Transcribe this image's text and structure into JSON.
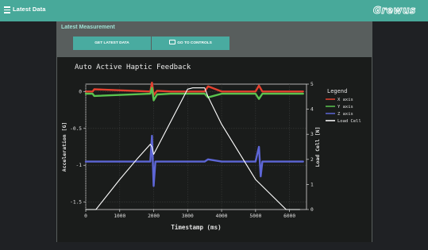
{
  "app": {
    "title": "Latest Data",
    "logo_text": "Grewus"
  },
  "panel": {
    "title": "Latest Measurement",
    "buttons": {
      "latest": "GET LATEST DATA",
      "controls": "GO TO CONTROLS"
    }
  },
  "colors": {
    "topbar": "#48a99a",
    "x_axis": "#e4412f",
    "y_axis": "#5ac44f",
    "z_axis": "#5d66d6",
    "load_cell": "#ffffff"
  },
  "chart_data": {
    "type": "line",
    "title": "Auto Active Haptic Feedback",
    "xlabel": "Timestamp (ms)",
    "ylabel_left": "Acceleration [G]",
    "ylabel_right": "Load Cell [N]",
    "xlim": [
      0,
      6500
    ],
    "ylim_left": [
      -1.6,
      0.1
    ],
    "ylim_right": [
      0,
      5
    ],
    "x_ticks": [
      "0",
      "1000",
      "2000",
      "3000",
      "4000",
      "5000",
      "6000"
    ],
    "y_ticks_left": [
      "0",
      "-0.5",
      "-1",
      "-1.5"
    ],
    "y_ticks_right": [
      "0",
      "1",
      "2",
      "3",
      "4",
      "5"
    ],
    "legend": {
      "title": "Legend",
      "position": "right",
      "entries": [
        "X axis",
        "Y axis",
        "Z axis",
        "Load Cell"
      ]
    },
    "series": [
      {
        "name": "X axis",
        "axis": "left",
        "x": [
          0,
          200,
          250,
          1900,
          1950,
          2000,
          2100,
          2500,
          3000,
          3500,
          3600,
          4000,
          5000,
          5100,
          5200,
          6400
        ],
        "y": [
          0.0,
          0.0,
          0.03,
          0.0,
          0.12,
          -0.05,
          0.01,
          0.0,
          0.0,
          0.0,
          0.07,
          0.0,
          0.0,
          0.08,
          0.0,
          0.0
        ]
      },
      {
        "name": "Y axis",
        "axis": "left",
        "x": [
          0,
          200,
          250,
          1900,
          1950,
          2000,
          2100,
          2500,
          3000,
          3500,
          3600,
          4000,
          5000,
          5100,
          5200,
          6400
        ],
        "y": [
          -0.03,
          -0.03,
          -0.06,
          -0.03,
          0.05,
          -0.12,
          -0.04,
          -0.03,
          -0.03,
          -0.03,
          -0.08,
          -0.03,
          -0.03,
          -0.1,
          -0.03,
          -0.03
        ]
      },
      {
        "name": "Z axis",
        "axis": "left",
        "x": [
          0,
          200,
          1900,
          1950,
          2000,
          2050,
          2500,
          3000,
          3500,
          3600,
          4000,
          5000,
          5100,
          5150,
          5200,
          6400
        ],
        "y": [
          -0.95,
          -0.95,
          -0.95,
          -0.6,
          -1.28,
          -0.95,
          -0.95,
          -0.95,
          -0.95,
          -0.92,
          -0.95,
          -0.95,
          -0.75,
          -1.15,
          -0.95,
          -0.95
        ]
      },
      {
        "name": "Load Cell",
        "axis": "right",
        "x": [
          0,
          300,
          1000,
          1500,
          1900,
          1950,
          2000,
          3000,
          3150,
          3500,
          3600,
          4000,
          5000,
          5900,
          6300
        ],
        "y": [
          0,
          0,
          1.2,
          2.0,
          2.6,
          2.5,
          2.2,
          4.8,
          4.85,
          4.85,
          4.5,
          3.4,
          1.2,
          0,
          0
        ]
      }
    ]
  }
}
